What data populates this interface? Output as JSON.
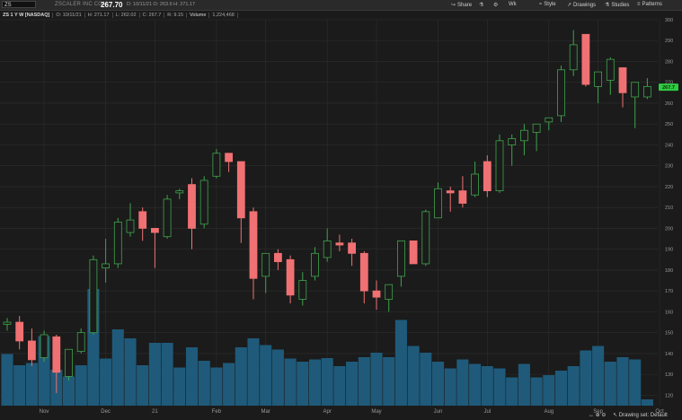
{
  "toolbar": {
    "symbol": "ZS",
    "company": "ZSCALER INC COM",
    "last_price": "267.70",
    "values_line1": "D: 10/11/21    O: 263.6    H: 271.17",
    "values_line2": "L: 262.02    C: 267.7    R: 9.15",
    "share": "Share",
    "period": "Wk",
    "style": "Style",
    "drawings": "Drawings",
    "studies": "Studies",
    "patterns": "Patterns"
  },
  "legend": {
    "study": "ZS 1 Y W [NASDAQ]",
    "o": "O: 10/11/21",
    "h": "H: 271.17",
    "l": "L: 262.02",
    "c": "C: 267.7",
    "r": "R: 9.15",
    "volume_label": "Volume",
    "volume_value": "1,224,468"
  },
  "status": {
    "drawing_set": "Drawing set: Default"
  },
  "colors": {
    "up": "#3fa34d",
    "down": "#f07173",
    "volume": "#1f5a7a",
    "grid": "#2e2e2e",
    "price_tag": "#2ecc40"
  },
  "chart_data": {
    "type": "candlestick",
    "title": "",
    "xlabel": "",
    "ylabel": "",
    "ylim": [
      115,
      300
    ],
    "y_ticks": [
      120,
      130,
      140,
      150,
      160,
      170,
      180,
      190,
      200,
      210,
      220,
      230,
      240,
      250,
      260,
      270,
      280,
      290,
      300
    ],
    "x_labels": [
      {
        "label": "Nov",
        "bar": 3
      },
      {
        "label": "Dec",
        "bar": 8
      },
      {
        "label": "21",
        "bar": 12
      },
      {
        "label": "Feb",
        "bar": 17
      },
      {
        "label": "Mar",
        "bar": 21
      },
      {
        "label": "Apr",
        "bar": 26
      },
      {
        "label": "May",
        "bar": 30
      },
      {
        "label": "Jun",
        "bar": 35
      },
      {
        "label": "Jul",
        "bar": 39
      },
      {
        "label": "Aug",
        "bar": 44
      },
      {
        "label": "Sep",
        "bar": 48
      },
      {
        "label": "Oct",
        "bar": 53
      }
    ],
    "current_price": 267.7,
    "candles": [
      {
        "o": 154,
        "h": 157,
        "l": 151,
        "c": 155
      },
      {
        "o": 155,
        "h": 158,
        "l": 142,
        "c": 146
      },
      {
        "o": 146,
        "h": 152,
        "l": 134,
        "c": 137
      },
      {
        "o": 138,
        "h": 151,
        "l": 136,
        "c": 149
      },
      {
        "o": 148,
        "h": 149,
        "l": 121,
        "c": 131
      },
      {
        "o": 129,
        "h": 141,
        "l": 127,
        "c": 142
      },
      {
        "o": 141,
        "h": 152,
        "l": 140,
        "c": 150
      },
      {
        "o": 150,
        "h": 187,
        "l": 149,
        "c": 185
      },
      {
        "o": 181,
        "h": 195,
        "l": 174,
        "c": 183
      },
      {
        "o": 183,
        "h": 205,
        "l": 181,
        "c": 203
      },
      {
        "o": 198,
        "h": 212,
        "l": 196,
        "c": 204
      },
      {
        "o": 208,
        "h": 210,
        "l": 194,
        "c": 200
      },
      {
        "o": 200,
        "h": 200,
        "l": 181,
        "c": 198
      },
      {
        "o": 196,
        "h": 216,
        "l": 195,
        "c": 214
      },
      {
        "o": 217,
        "h": 219,
        "l": 214,
        "c": 218
      },
      {
        "o": 221,
        "h": 224,
        "l": 190,
        "c": 200
      },
      {
        "o": 202,
        "h": 225,
        "l": 200,
        "c": 223
      },
      {
        "o": 225,
        "h": 238,
        "l": 224,
        "c": 236
      },
      {
        "o": 236,
        "h": 232,
        "l": 227,
        "c": 232
      },
      {
        "o": 232,
        "h": 232,
        "l": 193,
        "c": 205
      },
      {
        "o": 208,
        "h": 210,
        "l": 166,
        "c": 176
      },
      {
        "o": 177,
        "h": 188,
        "l": 169,
        "c": 188
      },
      {
        "o": 188,
        "h": 190,
        "l": 180,
        "c": 184
      },
      {
        "o": 185,
        "h": 187,
        "l": 164,
        "c": 168
      },
      {
        "o": 166,
        "h": 179,
        "l": 163,
        "c": 175
      },
      {
        "o": 177,
        "h": 191,
        "l": 175,
        "c": 188
      },
      {
        "o": 186,
        "h": 200,
        "l": 184,
        "c": 194
      },
      {
        "o": 193,
        "h": 197,
        "l": 189,
        "c": 192
      },
      {
        "o": 193,
        "h": 195,
        "l": 182,
        "c": 188
      },
      {
        "o": 188,
        "h": 189,
        "l": 164,
        "c": 170
      },
      {
        "o": 170,
        "h": 175,
        "l": 161,
        "c": 167
      },
      {
        "o": 166,
        "h": 173,
        "l": 160,
        "c": 173
      },
      {
        "o": 177,
        "h": 185,
        "l": 172,
        "c": 194
      },
      {
        "o": 194,
        "h": 194,
        "l": 184,
        "c": 183
      },
      {
        "o": 183,
        "h": 209,
        "l": 182,
        "c": 208
      },
      {
        "o": 205,
        "h": 222,
        "l": 205,
        "c": 219
      },
      {
        "o": 218,
        "h": 220,
        "l": 208,
        "c": 217
      },
      {
        "o": 218,
        "h": 225,
        "l": 210,
        "c": 212
      },
      {
        "o": 216,
        "h": 232,
        "l": 215,
        "c": 226
      },
      {
        "o": 232,
        "h": 235,
        "l": 215,
        "c": 218
      },
      {
        "o": 218,
        "h": 245,
        "l": 217,
        "c": 242
      },
      {
        "o": 240,
        "h": 245,
        "l": 230,
        "c": 243
      },
      {
        "o": 242,
        "h": 250,
        "l": 235,
        "c": 247
      },
      {
        "o": 246,
        "h": 250,
        "l": 237,
        "c": 250
      },
      {
        "o": 251,
        "h": 253,
        "l": 247,
        "c": 253
      },
      {
        "o": 254,
        "h": 278,
        "l": 251,
        "c": 276
      },
      {
        "o": 276,
        "h": 295,
        "l": 273,
        "c": 288
      },
      {
        "o": 293,
        "h": 293,
        "l": 268,
        "c": 269
      },
      {
        "o": 268,
        "h": 273,
        "l": 260,
        "c": 275
      },
      {
        "o": 271,
        "h": 282,
        "l": 264,
        "c": 281
      },
      {
        "o": 277,
        "h": 277,
        "l": 258,
        "c": 265
      },
      {
        "o": 263,
        "h": 270,
        "l": 248,
        "c": 270
      },
      {
        "o": 263,
        "h": 272,
        "l": 262,
        "c": 268
      }
    ],
    "volume_ylim": [
      0,
      3.0
    ],
    "volume": [
      1.15,
      0.9,
      0.95,
      1.55,
      0.8,
      0.65,
      0.9,
      2.6,
      1.05,
      1.7,
      1.5,
      0.9,
      1.4,
      1.4,
      0.85,
      1.3,
      1.0,
      0.85,
      0.95,
      1.3,
      1.5,
      1.35,
      1.25,
      1.05,
      0.98,
      1.03,
      1.06,
      0.88,
      0.98,
      1.08,
      1.18,
      1.08,
      1.91,
      1.33,
      1.18,
      0.98,
      0.83,
      1.03,
      0.93,
      0.88,
      0.83,
      0.63,
      0.93,
      0.63,
      0.68,
      0.78,
      0.88,
      1.23,
      1.33,
      0.98,
      1.08,
      1.03,
      0.14
    ]
  }
}
